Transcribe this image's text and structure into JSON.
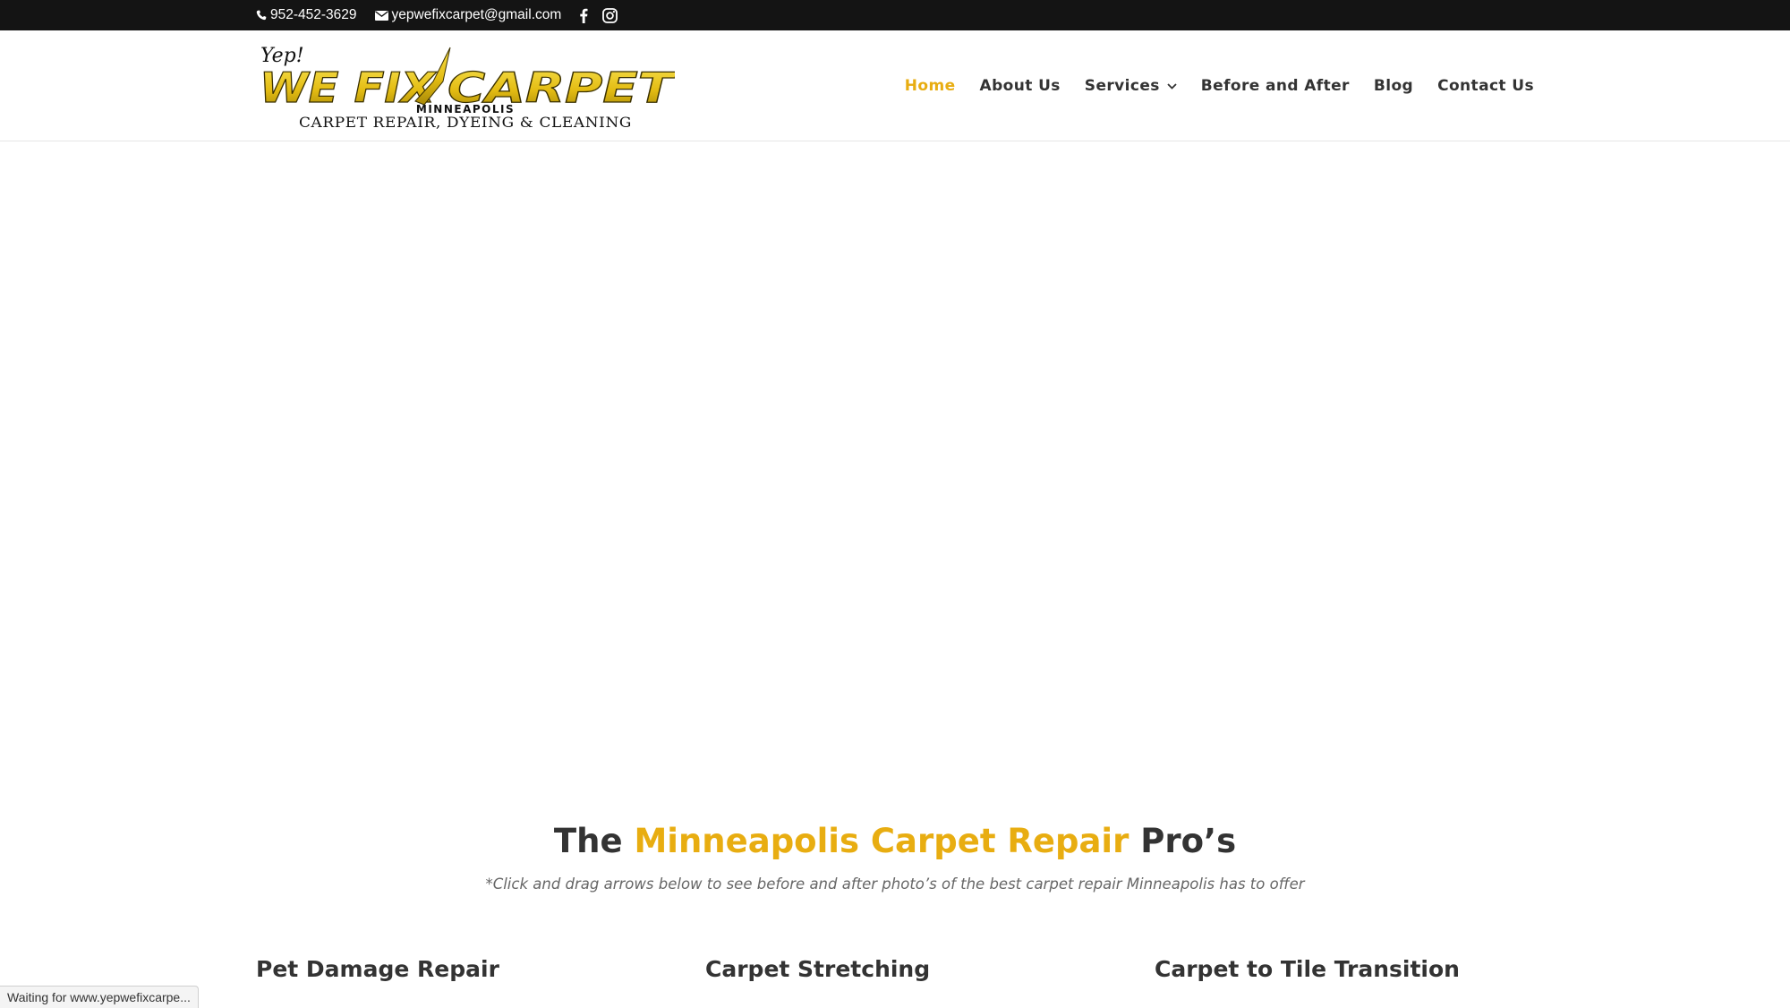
{
  "top_bar": {
    "phone": "952-452-3629",
    "email": "yepwefixcarpet@gmail.com",
    "social": [
      "facebook-icon",
      "instagram-icon"
    ]
  },
  "logo": {
    "tagline_small": "Yep!",
    "main": "WE FIXCARPET",
    "city": "MINNEAPOLIS",
    "services_line": "CARPET REPAIR, DYEING & CLEANING"
  },
  "nav": {
    "items": [
      {
        "label": "Home",
        "active": true
      },
      {
        "label": "About Us",
        "active": false
      },
      {
        "label": "Services",
        "active": false,
        "dropdown": true
      },
      {
        "label": "Before and After",
        "active": false
      },
      {
        "label": "Blog",
        "active": false
      },
      {
        "label": "Contact Us",
        "active": false
      }
    ]
  },
  "intro": {
    "title_prefix": "The",
    "title_highlight": "Minneapolis Carpet Repair",
    "title_suffix": "Pro’s",
    "subtitle": "*Click and drag arrows below to see before and after photo’s of the best carpet repair Minneapolis has to offer"
  },
  "services": [
    {
      "title": "Pet Damage Repair"
    },
    {
      "title": "Carpet Stretching"
    },
    {
      "title": "Carpet to Tile Transition"
    }
  ],
  "browser_status": "Waiting for www.yepwefixcarpe...",
  "colors": {
    "accent": "#e8ad11",
    "top_bar_bg": "#141414",
    "text": "#333333"
  }
}
